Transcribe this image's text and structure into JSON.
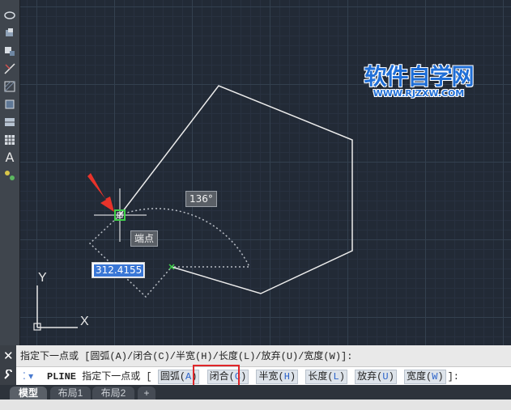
{
  "watermark": {
    "title": "软件自学网",
    "url": "WWW.RJZXW.COM"
  },
  "toolbar": {
    "text_tool": "A"
  },
  "canvas": {
    "angle_tip": "136°",
    "snap_tip": "端点",
    "length_input": "312.4155",
    "ucs": {
      "x": "X",
      "y": "Y"
    },
    "arrow_color": "#e8332a"
  },
  "command": {
    "close_glyph": "✕",
    "history": "指定下一点或 [圆弧(A)/闭合(C)/半宽(H)/长度(L)/放弃(U)/宽度(W)]:",
    "prompt_glyph": "⁚ ▾",
    "cmd_name": "PLINE",
    "prompt_text": " 指定下一点或 [",
    "options": [
      {
        "label": "圆弧",
        "key": "A"
      },
      {
        "label": "闭合",
        "key": "C"
      },
      {
        "label": "半宽",
        "key": "H"
      },
      {
        "label": "长度",
        "key": "L"
      },
      {
        "label": "放弃",
        "key": "U"
      },
      {
        "label": "宽度",
        "key": "W"
      }
    ],
    "suffix": "]:",
    "highlight_color": "#e0272a"
  },
  "tabs": {
    "model": "模型",
    "layout1": "布局1",
    "layout2": "布局2",
    "add": "+"
  }
}
